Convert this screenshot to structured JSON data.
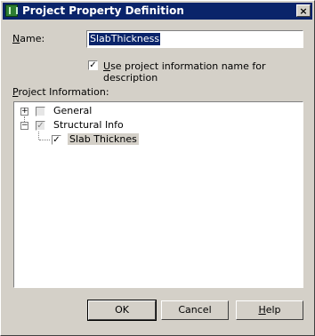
{
  "window": {
    "title": "Project Property Definition",
    "close_glyph": "×"
  },
  "form": {
    "name_label_hotkey": "N",
    "name_label_rest": "ame:",
    "name_value": "SlabThickness",
    "use_desc_label_hotkey": "U",
    "use_desc_label_rest": "se project information name for description",
    "use_desc_checked": true,
    "project_info_label_hotkey": "P",
    "project_info_label_rest": "roject Information:"
  },
  "tree": {
    "nodes": [
      {
        "label": "General",
        "expander": "+",
        "checked": false
      },
      {
        "label": "Structural Info",
        "expander": "−",
        "checked": true
      },
      {
        "label": "Slab Thicknes",
        "checked": true,
        "selected": true
      }
    ]
  },
  "buttons": {
    "ok": "OK",
    "cancel": "Cancel",
    "help_hotkey": "H",
    "help_rest": "elp"
  },
  "glyphs": {
    "check": "✓"
  }
}
